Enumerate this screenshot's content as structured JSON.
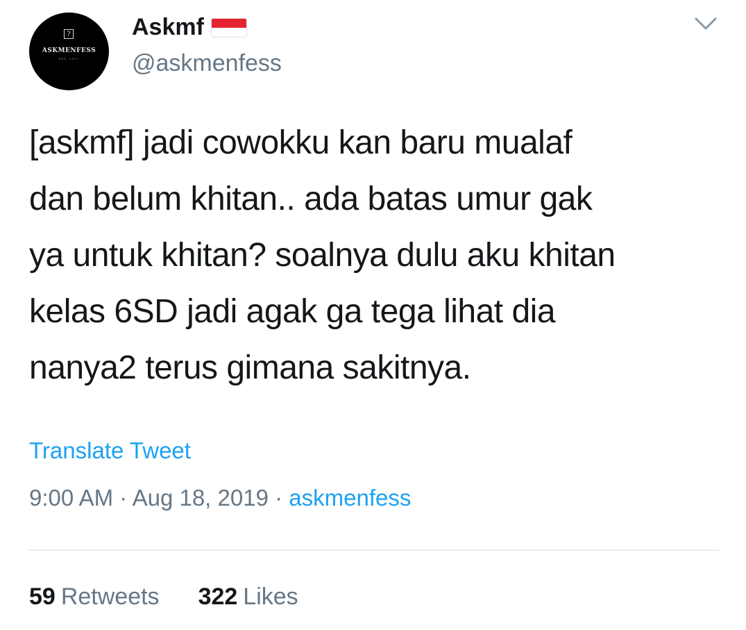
{
  "author": {
    "display_name": "Askmf",
    "handle": "@askmenfess",
    "flag_icon": "indonesia-flag-icon",
    "avatar": {
      "logo_mark": "?",
      "logo_text": "ASKMENFESS",
      "logo_subtext": "EST. 2017"
    }
  },
  "tweet": {
    "text": "[askmf] jadi cowokku kan baru mualaf\ndan belum khitan.. ada batas umur gak\nya untuk khitan? soalnya dulu aku khitan\nkelas 6SD jadi agak ga tega lihat dia\nnanya2 terus gimana sakitnya.",
    "translate_label": "Translate Tweet",
    "time": "9:00 AM",
    "separator": " · ",
    "date": "Aug 18, 2019",
    "source": "askmenfess"
  },
  "stats": {
    "retweets_count": "59",
    "retweets_label": "Retweets",
    "likes_count": "322",
    "likes_label": "Likes"
  },
  "colors": {
    "link": "#1da1f2",
    "secondary_text": "#657786",
    "primary_text": "#14171a",
    "divider": "#e6ecf0"
  },
  "icons": {
    "menu": "chevron-down-icon"
  }
}
